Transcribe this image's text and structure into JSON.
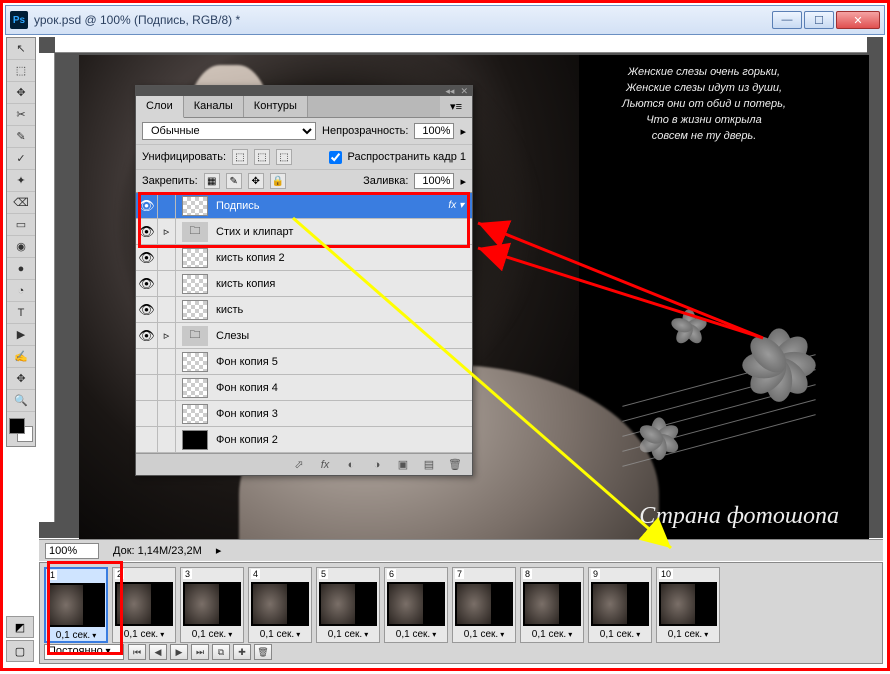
{
  "window": {
    "title": "урок.psd @ 100% (Подпись, RGB/8) *",
    "min": "—",
    "max": "☐",
    "close": "✕"
  },
  "tools": [
    "↖",
    "⬚",
    "✥",
    "✂",
    "✎",
    "✓",
    "✦",
    "⌫",
    "▭",
    "◉",
    "●",
    "◔",
    "T",
    "▶",
    "✍",
    "✥",
    "🔍"
  ],
  "canvas": {
    "poem_l1": "Женские слезы очень горьки,",
    "poem_l2": "Женские слезы идут из души,",
    "poem_l3": "Льются они от обид и потерь,",
    "poem_l4": "Что в жизни открыла",
    "poem_l5": "совсем не ту дверь.",
    "signature": "Страна фотошопа"
  },
  "zoom": {
    "value": "100%",
    "doc": "Док:  1,14M/23,2M"
  },
  "layersPanel": {
    "tabs": [
      "Слои",
      "Каналы",
      "Контуры"
    ],
    "blend": "Обычные",
    "opacityLabel": "Непрозрачность:",
    "opacity": "100%",
    "unifyLabel": "Унифицировать:",
    "propagate": "Распространить кадр 1",
    "lockLabel": "Закрепить:",
    "fillLabel": "Заливка:",
    "fill": "100%",
    "layers": [
      {
        "eye": "👁",
        "name": "Подпись",
        "sel": true,
        "fx": "fx ▾",
        "thumb": "t"
      },
      {
        "eye": "👁",
        "name": "Стих и клипарт",
        "folder": true,
        "arrow": "▹"
      },
      {
        "eye": "👁",
        "name": "кисть копия 2",
        "thumb": "t"
      },
      {
        "eye": "👁",
        "name": "кисть копия",
        "thumb": "t"
      },
      {
        "eye": "👁",
        "name": "кисть",
        "thumb": "t"
      },
      {
        "eye": "👁",
        "name": "Слезы",
        "folder": true,
        "arrow": "▹"
      },
      {
        "eye": "",
        "name": "Фон копия 5",
        "thumb": "t"
      },
      {
        "eye": "",
        "name": "Фон копия 4",
        "thumb": "t"
      },
      {
        "eye": "",
        "name": "Фон копия 3",
        "thumb": "t"
      },
      {
        "eye": "",
        "name": "Фон копия 2",
        "thumb": "s"
      }
    ]
  },
  "timeline": {
    "frames": [
      {
        "n": "1",
        "d": "0,1 сек.",
        "sel": true
      },
      {
        "n": "2",
        "d": "0,1 сек."
      },
      {
        "n": "3",
        "d": "0,1 сек."
      },
      {
        "n": "4",
        "d": "0,1 сек."
      },
      {
        "n": "5",
        "d": "0,1 сек."
      },
      {
        "n": "6",
        "d": "0,1 сек."
      },
      {
        "n": "7",
        "d": "0,1 сек."
      },
      {
        "n": "8",
        "d": "0,1 сек."
      },
      {
        "n": "9",
        "d": "0,1 сек."
      },
      {
        "n": "10",
        "d": "0,1 сек."
      }
    ],
    "loop": "Постоянно",
    "buttons": [
      "⏮",
      "◀",
      "▶",
      "⏭",
      "⧉",
      "✚",
      "🗑"
    ]
  }
}
